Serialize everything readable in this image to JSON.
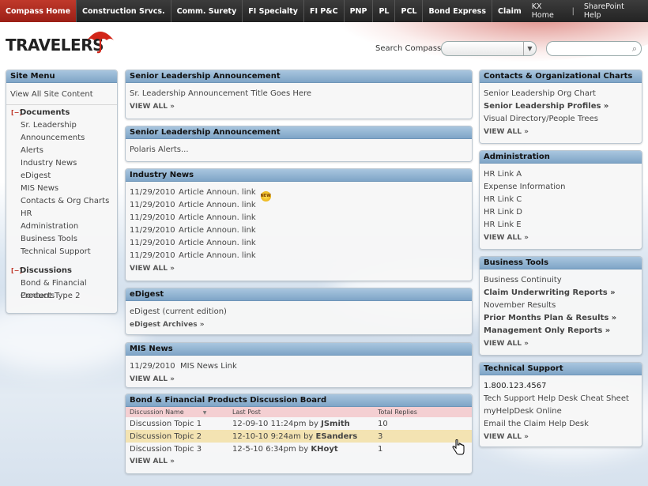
{
  "topnav": {
    "tabs": [
      "Compass Home",
      "Construction Srvcs.",
      "Comm. Surety",
      "FI Specialty",
      "FI P&C",
      "PNP",
      "PL",
      "PCL",
      "Bond Express",
      "Claim"
    ],
    "right": {
      "kx_home": "KX Home",
      "separator": "|",
      "sharepoint_help": "SharePoint Help"
    }
  },
  "header": {
    "logo_text": "TRAVELERS",
    "search_label": "Search Compass:",
    "search_scope": "",
    "search_value": ""
  },
  "site_menu": {
    "title": "Site Menu",
    "view_all": "View All Site Content",
    "documents": {
      "heading": "Documents",
      "items": [
        "Sr. Leadership",
        "Announcements",
        "Alerts",
        "Industry News",
        "eDigest",
        "MIS News",
        "Contacts & Org Charts",
        "HR",
        "Administration",
        "Business Tools",
        "Technical Support"
      ]
    },
    "discussions": {
      "heading": "Discussions",
      "items": [
        "Bond & Financial Products",
        "Content Type 2"
      ]
    }
  },
  "announcement1": {
    "title": "Senior Leadership Announcement",
    "item": "Sr. Leadership Announcement Title Goes Here",
    "view_all": "VIEW ALL »"
  },
  "announcement2": {
    "title": "Senior Leadership Announcement",
    "item": "Polaris Alerts..."
  },
  "industry_news": {
    "title": "Industry News",
    "items": [
      {
        "date": "11/29/2010",
        "text": "Article Announ. link",
        "badge": "NEW"
      },
      {
        "date": "11/29/2010",
        "text": "Article Announ. link"
      },
      {
        "date": "11/29/2010",
        "text": "Article Announ. link"
      },
      {
        "date": "11/29/2010",
        "text": "Article Announ. link"
      },
      {
        "date": "11/29/2010",
        "text": "Article Announ. link"
      },
      {
        "date": "11/29/2010",
        "text": "Article Announ. link"
      }
    ],
    "view_all": "VIEW ALL »"
  },
  "edigest": {
    "title": "eDigest",
    "item": "eDigest (current edition)",
    "archives": "eDigest Archives »"
  },
  "mis_news": {
    "title": "MIS News",
    "item": "11/29/2010  MIS News Link",
    "view_all": "VIEW ALL »"
  },
  "discussion_board": {
    "title": "Bond & Financial Products Discussion Board",
    "columns": [
      "Discussion Name",
      "Last Post",
      "Total Replies"
    ],
    "rows": [
      {
        "name": "Discussion Topic 1",
        "post": "12-09-10 11:24pm by",
        "author": "JSmith",
        "replies": "10"
      },
      {
        "name": "Discussion Topic 2",
        "post": "12-10-10 9:24am by",
        "author": "ESanders",
        "replies": "3"
      },
      {
        "name": "Discussion Topic 3",
        "post": "12-5-10 6:34pm by",
        "author": "KHoyt",
        "replies": "1"
      }
    ],
    "view_all": "VIEW ALL »"
  },
  "contacts": {
    "title": "Contacts & Organizational Charts",
    "items": [
      "Senior Leadership Org Chart",
      "Senior Leadership Profiles »",
      "Visual Directory/People Trees"
    ],
    "view_all": "VIEW ALL »"
  },
  "administration": {
    "title": "Administration",
    "items": [
      "HR Link A",
      "Expense Information",
      "HR Link C",
      "HR Link D",
      "HR Link E"
    ],
    "view_all": "VIEW ALL »"
  },
  "business_tools": {
    "title": "Business Tools",
    "items": [
      "Business Continuity",
      "Claim Underwriting Reports »",
      "November Results",
      "Prior Months Plan & Results »",
      "Management Only Reports »"
    ],
    "view_all": "VIEW ALL »"
  },
  "technical_support": {
    "title": "Technical Support",
    "items": [
      "1.800.123.4567",
      "Tech Support Help Desk Cheat Sheet",
      "myHelpDesk Online",
      "Email the Claim Help Desk"
    ],
    "view_all": "VIEW ALL »"
  }
}
